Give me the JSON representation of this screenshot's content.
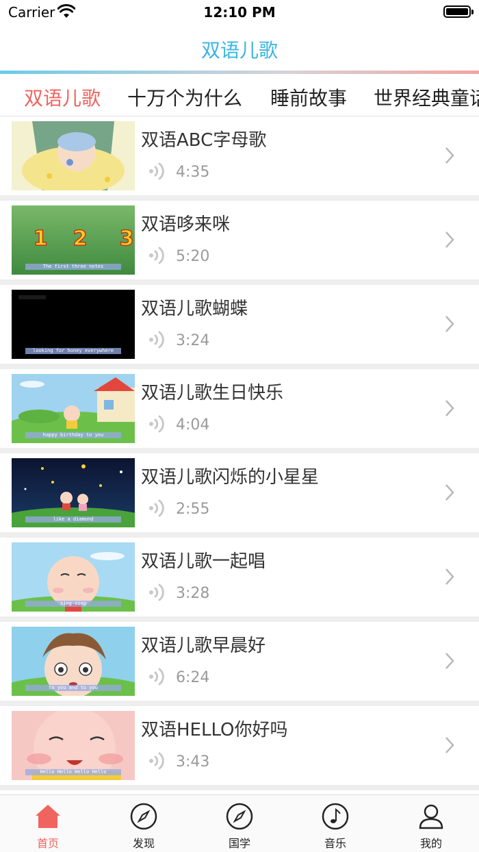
{
  "status": {
    "carrier": "Carrier",
    "time": "12:10 PM"
  },
  "nav": {
    "title": "双语儿歌"
  },
  "categories": [
    {
      "label": "双语儿歌",
      "active": true
    },
    {
      "label": "十万个为什么",
      "active": false
    },
    {
      "label": "睡前故事",
      "active": false
    },
    {
      "label": "世界经典童话",
      "active": false
    }
  ],
  "songs": [
    {
      "title": "双语ABC字母歌",
      "duration": "4:35",
      "caption": ""
    },
    {
      "title": "双语哆来咪",
      "duration": "5:20",
      "caption": "The first three notes",
      "numbers": [
        "1",
        "2",
        "3"
      ]
    },
    {
      "title": "双语儿歌蝴蝶",
      "duration": "3:24",
      "caption": "looking for honey everywhere"
    },
    {
      "title": "双语儿歌生日快乐",
      "duration": "4:04",
      "caption": "happy birthday to you"
    },
    {
      "title": "双语儿歌闪烁的小星星",
      "duration": "2:55",
      "caption": "like a diamond"
    },
    {
      "title": "双语儿歌一起唱",
      "duration": "3:28",
      "caption": "sing sing"
    },
    {
      "title": "双语儿歌早晨好",
      "duration": "6:24",
      "caption": "to you and to you"
    },
    {
      "title": "双语HELLO你好吗",
      "duration": "3:43",
      "caption": "Hello Hello Hello Hello"
    }
  ],
  "tabbar": [
    {
      "label": "首页",
      "icon": "home-icon",
      "active": true
    },
    {
      "label": "发现",
      "icon": "compass-icon",
      "active": false
    },
    {
      "label": "国学",
      "icon": "compass-icon",
      "active": false
    },
    {
      "label": "音乐",
      "icon": "music-note-icon",
      "active": false
    },
    {
      "label": "我的",
      "icon": "user-icon",
      "active": false
    }
  ],
  "colors": {
    "accent": "#f0645f",
    "title_blue": "#3ab5e3"
  }
}
